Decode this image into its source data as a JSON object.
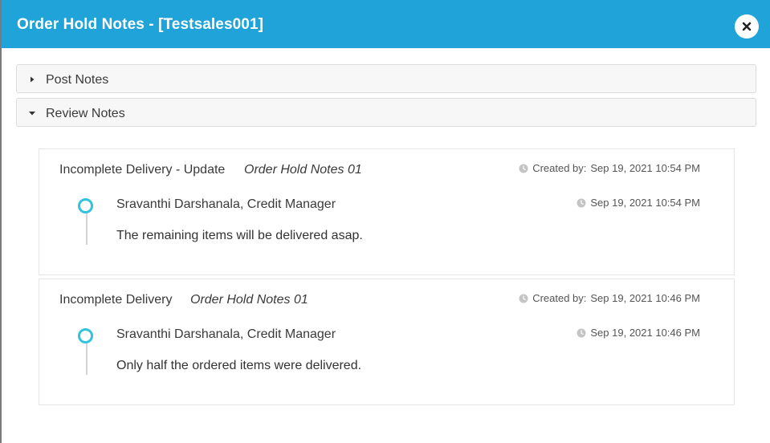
{
  "modal": {
    "title": "Order Hold Notes - [Testsales001]",
    "close_icon": "close-icon",
    "colors": {
      "header": "#20a3d8",
      "timeline": "#33c2dc"
    }
  },
  "accordion": [
    {
      "label": "Post Notes",
      "expanded": false,
      "icon": "caret-right-icon"
    },
    {
      "label": "Review Notes",
      "expanded": true,
      "icon": "caret-down-icon"
    }
  ],
  "notes": [
    {
      "title": "Incomplete Delivery - Update",
      "subtitle": "Order Hold Notes 01",
      "created_label": "Created by:",
      "created_at": "Sep 19, 2021 10:54 PM",
      "author": "Sravanthi Darshanala, Credit Manager",
      "entry_time": "Sep 19, 2021 10:54 PM",
      "text": "The remaining items will be delivered asap."
    },
    {
      "title": "Incomplete Delivery",
      "subtitle": "Order Hold Notes 01",
      "created_label": "Created by:",
      "created_at": "Sep 19, 2021 10:46 PM",
      "author": "Sravanthi Darshanala, Credit Manager",
      "entry_time": "Sep 19, 2021 10:46 PM",
      "text": "Only half the ordered items were delivered."
    }
  ]
}
